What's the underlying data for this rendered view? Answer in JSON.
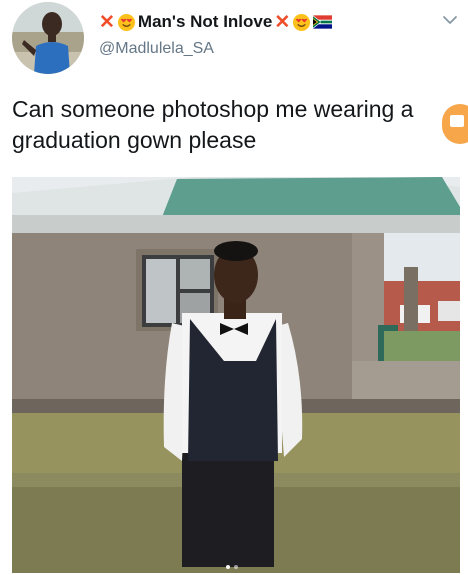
{
  "tweet": {
    "display_name": "Man's Not Inlove",
    "handle": "@Madlulela_SA",
    "text": "Can someone photoshop me wearing a graduation gown please",
    "name_icons": [
      "cross-mark-icon",
      "heart-eyes-emoji-icon",
      "cross-mark-icon",
      "heart-eyes-emoji-icon",
      "south-africa-flag-icon"
    ],
    "menu_icon": "chevron-down-icon"
  },
  "media": {
    "alt_icon": "photo",
    "carousel_pages": 2,
    "carousel_current": 1
  },
  "colors": {
    "text_primary": "#14171a",
    "text_secondary": "#657786",
    "accent_orange": "#f7a64a",
    "cross_red": "#f04e2b"
  }
}
